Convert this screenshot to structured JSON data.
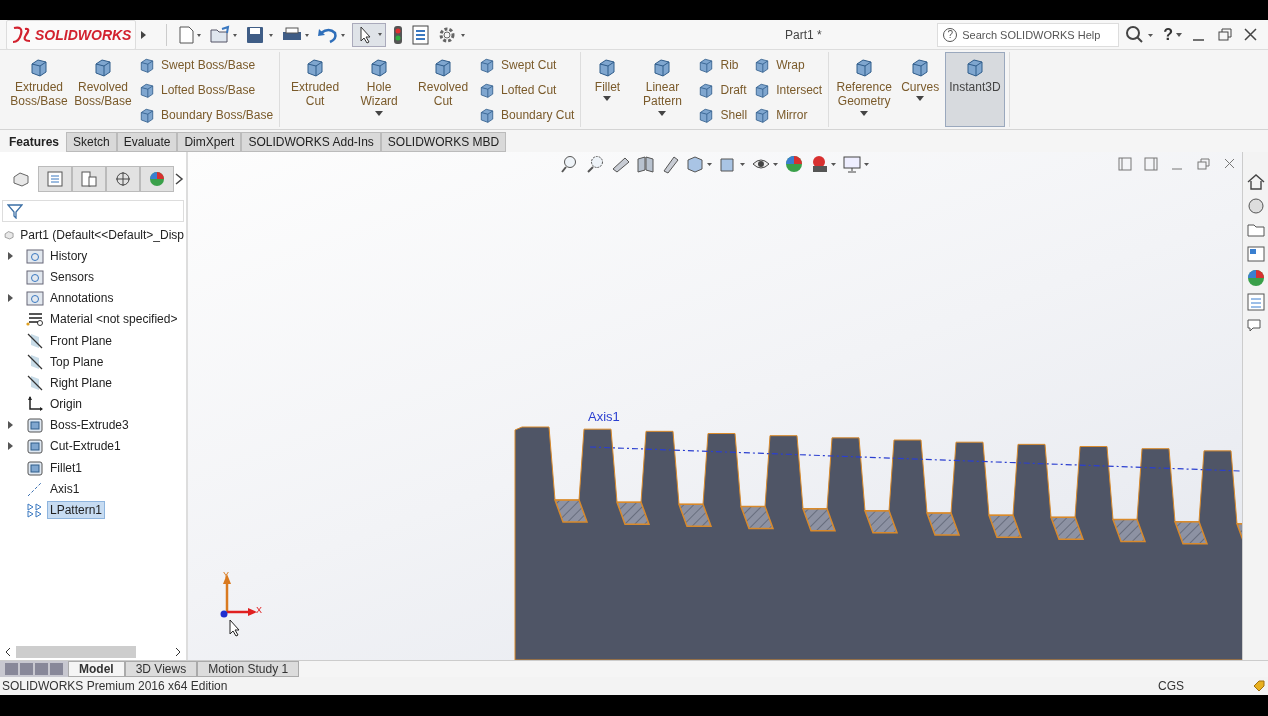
{
  "window": {
    "logo": "SOLIDWORKS",
    "title": "Part1 *",
    "select_tool_active": true
  },
  "help_search": {
    "icon": "?",
    "placeholder": "Search SOLIDWORKS Help"
  },
  "help_menu": {
    "symbol": "?"
  },
  "ribbon": {
    "groups": [
      {
        "items": [
          {
            "kind": "large",
            "label": "Extruded Boss/Base",
            "dropdown": false,
            "on": false
          },
          {
            "kind": "large",
            "label": "Revolved Boss/Base",
            "dropdown": false,
            "on": false
          },
          {
            "kind": "stack",
            "entries": [
              "Swept Boss/Base",
              "Lofted Boss/Base",
              "Boundary Boss/Base"
            ]
          }
        ]
      },
      {
        "items": [
          {
            "kind": "large",
            "label": "Extruded Cut",
            "dropdown": false,
            "on": false
          },
          {
            "kind": "large",
            "label": "Hole Wizard",
            "dropdown": true,
            "on": false
          },
          {
            "kind": "large",
            "label": "Revolved Cut",
            "dropdown": false,
            "on": false
          },
          {
            "kind": "stack",
            "entries": [
              "Swept Cut",
              "Lofted Cut",
              "Boundary Cut"
            ]
          }
        ]
      },
      {
        "items": [
          {
            "kind": "large",
            "label": "Fillet",
            "dropdown": true,
            "on": false
          },
          {
            "kind": "large",
            "label": "Linear Pattern",
            "dropdown": true,
            "on": false
          },
          {
            "kind": "stack",
            "entries": [
              "Rib",
              "Draft",
              "Shell"
            ]
          },
          {
            "kind": "stack",
            "entries": [
              "Wrap",
              "Intersect",
              "Mirror"
            ]
          }
        ]
      },
      {
        "items": [
          {
            "kind": "large",
            "label": "Reference Geometry",
            "dropdown": true,
            "on": false
          },
          {
            "kind": "large",
            "label": "Curves",
            "dropdown": true,
            "on": false
          },
          {
            "kind": "large",
            "label": "Instant3D",
            "dropdown": false,
            "on": true
          }
        ]
      }
    ]
  },
  "command_tabs": [
    {
      "label": "Features",
      "selected": true
    },
    {
      "label": "Sketch",
      "selected": false
    },
    {
      "label": "Evaluate",
      "selected": false
    },
    {
      "label": "DimXpert",
      "selected": false
    },
    {
      "label": "SOLIDWORKS Add-Ins",
      "selected": false
    },
    {
      "label": "SOLIDWORKS MBD",
      "selected": false
    }
  ],
  "panel_tabs": [
    {
      "selected": true
    },
    {
      "selected": false
    },
    {
      "selected": false
    },
    {
      "selected": false
    },
    {
      "selected": false
    }
  ],
  "tree": {
    "root": "Part1  (Default<<Default>_Disp",
    "items": [
      {
        "label": "History",
        "kind": "folder",
        "expandable": true,
        "selected": false
      },
      {
        "label": "Sensors",
        "kind": "folder",
        "expandable": false,
        "selected": false
      },
      {
        "label": "Annotations",
        "kind": "folder",
        "expandable": true,
        "selected": false
      },
      {
        "label": "Material <not specified>",
        "kind": "material",
        "expandable": false,
        "selected": false
      },
      {
        "label": "Front Plane",
        "kind": "plane",
        "expandable": false,
        "selected": false
      },
      {
        "label": "Top Plane",
        "kind": "plane",
        "expandable": false,
        "selected": false
      },
      {
        "label": "Right Plane",
        "kind": "plane",
        "expandable": false,
        "selected": false
      },
      {
        "label": "Origin",
        "kind": "origin",
        "expandable": false,
        "selected": false
      },
      {
        "label": "Boss-Extrude3",
        "kind": "feature",
        "expandable": true,
        "selected": false
      },
      {
        "label": "Cut-Extrude1",
        "kind": "feature",
        "expandable": true,
        "selected": false
      },
      {
        "label": "Fillet1",
        "kind": "feature",
        "expandable": false,
        "selected": false
      },
      {
        "label": "Axis1",
        "kind": "axis",
        "expandable": false,
        "selected": false
      },
      {
        "label": "LPattern1",
        "kind": "pattern",
        "expandable": false,
        "selected": true
      }
    ]
  },
  "graphics": {
    "axis_label": "Axis1",
    "triad": {
      "x": "X",
      "y": "Y"
    }
  },
  "bottom_tabs": [
    {
      "label": "Model",
      "selected": true
    },
    {
      "label": "3D Views",
      "selected": false
    },
    {
      "label": "Motion Study 1",
      "selected": false
    }
  ],
  "status_bar": {
    "edition": "SOLIDWORKS Premium 2016 x64 Edition",
    "units": "CGS"
  }
}
